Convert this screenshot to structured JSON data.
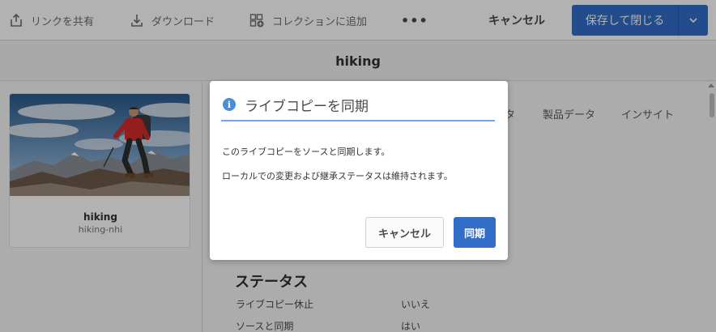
{
  "toolbar": {
    "share_label": "リンクを共有",
    "download_label": "ダウンロード",
    "collection_label": "コレクションに追加",
    "more_label": "•••",
    "cancel_label": "キャンセル",
    "save_close_label": "保存して閉じる"
  },
  "page_title": "hiking",
  "asset_card": {
    "title": "hiking",
    "subtitle": "hiking-nhi"
  },
  "tabs": [
    "タ",
    "製品データ",
    "インサイト"
  ],
  "status": {
    "heading": "ステータス",
    "rows": [
      {
        "label": "ライブコピー休止",
        "value": "いいえ"
      },
      {
        "label": "ソースと同期",
        "value": "はい"
      }
    ]
  },
  "dialog": {
    "title": "ライブコピーを同期",
    "line1": "このライブコピーをソースと同期します。",
    "line2": "ローカルでの変更および継承ステータスは維持されます。",
    "cancel_label": "キャンセル",
    "sync_label": "同期"
  },
  "colors": {
    "primary": "#326ec8",
    "info": "#4a8ed9",
    "dialog_underline": "#6ea8e6"
  },
  "icons": {
    "share": "share-icon",
    "download": "download-icon",
    "collection": "collection-add-icon",
    "info": "info-icon",
    "dropdown": "chevron-down-icon"
  }
}
